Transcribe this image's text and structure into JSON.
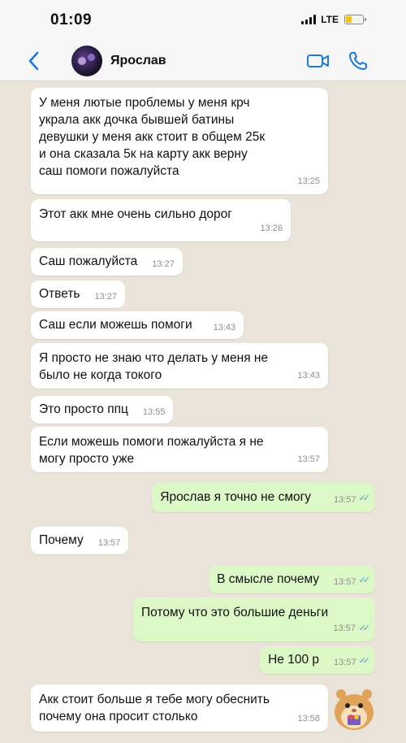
{
  "status_bar": {
    "time": "01:09",
    "network": "LTE",
    "battery_level": 0.35
  },
  "header": {
    "back_icon": "chevron-left-icon",
    "contact_name": "Ярослав",
    "video_icon": "video-camera-icon",
    "call_icon": "phone-icon",
    "accent_color": "#1a7bd8"
  },
  "messages": [
    {
      "direction": "in",
      "text": "У меня лютые проблемы у меня крч\nукрала акк дочка бывшей батины\nдевушки у меня акк стоит в общем 25к\nи она сказала 5к на карту акк верну\nсаш помоги пожалуйста",
      "time": "13:25"
    },
    {
      "direction": "in",
      "text": "Этот акк мне очень сильно дорог",
      "time": "13:26"
    },
    {
      "direction": "in",
      "text": "Саш пожалуйста",
      "time": "13:27"
    },
    {
      "direction": "in",
      "text": "Ответь",
      "time": "13:27"
    },
    {
      "direction": "in",
      "text": "Саш если можешь помоги",
      "time": "13:43"
    },
    {
      "direction": "in",
      "text": "Я просто не знаю что делать у меня не\nбыло не когда токого",
      "time": "13:43"
    },
    {
      "direction": "in",
      "text": "Это просто ппц",
      "time": "13:55"
    },
    {
      "direction": "in",
      "text": "Если можешь помоги пожалуйста я не\nмогу просто уже",
      "time": "13:57"
    },
    {
      "direction": "out",
      "text": "Ярослав я точно не смогу",
      "time": "13:57",
      "read": true
    },
    {
      "direction": "in",
      "text": "Почему",
      "time": "13:57"
    },
    {
      "direction": "out",
      "text": "В смысле почему",
      "time": "13:57",
      "read": true
    },
    {
      "direction": "out",
      "text": "Потому что это большие деньги",
      "time": "13:57",
      "read": true
    },
    {
      "direction": "out",
      "text": "Не 100 р",
      "time": "13:57",
      "read": true
    },
    {
      "direction": "in",
      "text": "Акк стоит больше я тебе могу обеснить\nпочему она просит столько",
      "time": "13:58"
    }
  ],
  "colors": {
    "incoming_bubble": "#ffffff",
    "outgoing_bubble": "#dcf8c6",
    "chat_background": "#e9e3d9",
    "read_ticks": "#4fa3d9"
  },
  "sticker_icon": "hamster-sticker-icon"
}
